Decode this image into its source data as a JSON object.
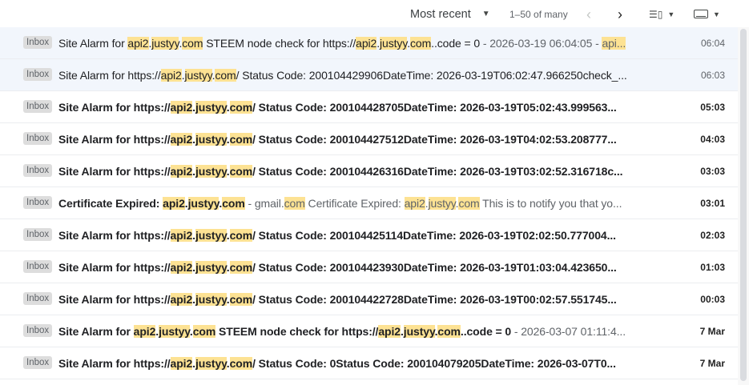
{
  "toolbar": {
    "sort_label": "Most recent",
    "range": "1–50 of many"
  },
  "emails": [
    {
      "label": "Inbox",
      "unread": false,
      "segments": [
        {
          "t": "Site Alarm for ",
          "s": "subject"
        },
        {
          "t": "api2",
          "s": "subject",
          "hl": true
        },
        {
          "t": ".",
          "s": "subject"
        },
        {
          "t": "justyy",
          "s": "subject",
          "hl": true
        },
        {
          "t": ".",
          "s": "subject"
        },
        {
          "t": "com",
          "s": "subject",
          "hl": true
        },
        {
          "t": " STEEM node check for https://",
          "s": "subject"
        },
        {
          "t": "api2",
          "s": "subject",
          "hl": true
        },
        {
          "t": ".",
          "s": "subject"
        },
        {
          "t": "justyy",
          "s": "subject",
          "hl": true
        },
        {
          "t": ".",
          "s": "subject"
        },
        {
          "t": "com",
          "s": "subject",
          "hl": true
        },
        {
          "t": "..code = 0",
          "s": "subject"
        },
        {
          "t": " - 2026-03-19 06:04:05 - ",
          "s": "snippet"
        },
        {
          "t": "api...",
          "s": "snippet",
          "hl": true
        }
      ],
      "date": "06:04"
    },
    {
      "label": "Inbox",
      "unread": false,
      "segments": [
        {
          "t": "Site Alarm for https://",
          "s": "subject"
        },
        {
          "t": "api2",
          "s": "subject",
          "hl": true
        },
        {
          "t": ".",
          "s": "subject"
        },
        {
          "t": "justyy",
          "s": "subject",
          "hl": true
        },
        {
          "t": ".",
          "s": "subject"
        },
        {
          "t": "com",
          "s": "subject",
          "hl": true
        },
        {
          "t": "/ Status Code: 200104429906DateTime: 2026-03-19T06:02:47.966250check_...",
          "s": "subject"
        }
      ],
      "date": "06:03"
    },
    {
      "label": "Inbox",
      "unread": true,
      "segments": [
        {
          "t": "Site Alarm for https://",
          "s": "subject"
        },
        {
          "t": "api2",
          "s": "subject",
          "hl": true
        },
        {
          "t": ".",
          "s": "subject"
        },
        {
          "t": "justyy",
          "s": "subject",
          "hl": true
        },
        {
          "t": ".",
          "s": "subject"
        },
        {
          "t": "com",
          "s": "subject",
          "hl": true
        },
        {
          "t": "/ Status Code: 200104428705DateTime: 2026-03-19T05:02:43.999563...",
          "s": "subject"
        }
      ],
      "date": "05:03"
    },
    {
      "label": "Inbox",
      "unread": true,
      "segments": [
        {
          "t": "Site Alarm for https://",
          "s": "subject"
        },
        {
          "t": "api2",
          "s": "subject",
          "hl": true
        },
        {
          "t": ".",
          "s": "subject"
        },
        {
          "t": "justyy",
          "s": "subject",
          "hl": true
        },
        {
          "t": ".",
          "s": "subject"
        },
        {
          "t": "com",
          "s": "subject",
          "hl": true
        },
        {
          "t": "/ Status Code: 200104427512DateTime: 2026-03-19T04:02:53.208777...",
          "s": "subject"
        }
      ],
      "date": "04:03"
    },
    {
      "label": "Inbox",
      "unread": true,
      "segments": [
        {
          "t": "Site Alarm for https://",
          "s": "subject"
        },
        {
          "t": "api2",
          "s": "subject",
          "hl": true
        },
        {
          "t": ".",
          "s": "subject"
        },
        {
          "t": "justyy",
          "s": "subject",
          "hl": true
        },
        {
          "t": ".",
          "s": "subject"
        },
        {
          "t": "com",
          "s": "subject",
          "hl": true
        },
        {
          "t": "/ Status Code: 200104426316DateTime: 2026-03-19T03:02:52.316718c...",
          "s": "subject"
        }
      ],
      "date": "03:03"
    },
    {
      "label": "Inbox",
      "unread": true,
      "segments": [
        {
          "t": "Certificate Expired: ",
          "s": "subject"
        },
        {
          "t": "api2",
          "s": "subject",
          "hl": true
        },
        {
          "t": ".",
          "s": "subject"
        },
        {
          "t": "justyy",
          "s": "subject",
          "hl": true
        },
        {
          "t": ".",
          "s": "subject"
        },
        {
          "t": "com",
          "s": "subject",
          "hl": true
        },
        {
          "t": " - gmail.",
          "s": "snippet"
        },
        {
          "t": "com",
          "s": "snippet",
          "hl": true
        },
        {
          "t": " Certificate Expired: ",
          "s": "snippet"
        },
        {
          "t": "api2",
          "s": "snippet",
          "hl": true
        },
        {
          "t": ".",
          "s": "snippet"
        },
        {
          "t": "justyy",
          "s": "snippet",
          "hl": true
        },
        {
          "t": ".",
          "s": "snippet"
        },
        {
          "t": "com",
          "s": "snippet",
          "hl": true
        },
        {
          "t": " This is to notify you that yo...",
          "s": "snippet"
        }
      ],
      "date": "03:01"
    },
    {
      "label": "Inbox",
      "unread": true,
      "segments": [
        {
          "t": "Site Alarm for https://",
          "s": "subject"
        },
        {
          "t": "api2",
          "s": "subject",
          "hl": true
        },
        {
          "t": ".",
          "s": "subject"
        },
        {
          "t": "justyy",
          "s": "subject",
          "hl": true
        },
        {
          "t": ".",
          "s": "subject"
        },
        {
          "t": "com",
          "s": "subject",
          "hl": true
        },
        {
          "t": "/ Status Code: 200104425114DateTime: 2026-03-19T02:02:50.777004...",
          "s": "subject"
        }
      ],
      "date": "02:03"
    },
    {
      "label": "Inbox",
      "unread": true,
      "segments": [
        {
          "t": "Site Alarm for https://",
          "s": "subject"
        },
        {
          "t": "api2",
          "s": "subject",
          "hl": true
        },
        {
          "t": ".",
          "s": "subject"
        },
        {
          "t": "justyy",
          "s": "subject",
          "hl": true
        },
        {
          "t": ".",
          "s": "subject"
        },
        {
          "t": "com",
          "s": "subject",
          "hl": true
        },
        {
          "t": "/ Status Code: 200104423930DateTime: 2026-03-19T01:03:04.423650...",
          "s": "subject"
        }
      ],
      "date": "01:03"
    },
    {
      "label": "Inbox",
      "unread": true,
      "segments": [
        {
          "t": "Site Alarm for https://",
          "s": "subject"
        },
        {
          "t": "api2",
          "s": "subject",
          "hl": true
        },
        {
          "t": ".",
          "s": "subject"
        },
        {
          "t": "justyy",
          "s": "subject",
          "hl": true
        },
        {
          "t": ".",
          "s": "subject"
        },
        {
          "t": "com",
          "s": "subject",
          "hl": true
        },
        {
          "t": "/ Status Code: 200104422728DateTime: 2026-03-19T00:02:57.551745...",
          "s": "subject"
        }
      ],
      "date": "00:03"
    },
    {
      "label": "Inbox",
      "unread": true,
      "segments": [
        {
          "t": "Site Alarm for ",
          "s": "subject"
        },
        {
          "t": "api2",
          "s": "subject",
          "hl": true
        },
        {
          "t": ".",
          "s": "subject"
        },
        {
          "t": "justyy",
          "s": "subject",
          "hl": true
        },
        {
          "t": ".",
          "s": "subject"
        },
        {
          "t": "com",
          "s": "subject",
          "hl": true
        },
        {
          "t": " STEEM node check for https://",
          "s": "subject"
        },
        {
          "t": "api2",
          "s": "subject",
          "hl": true
        },
        {
          "t": ".",
          "s": "subject"
        },
        {
          "t": "justyy",
          "s": "subject",
          "hl": true
        },
        {
          "t": ".",
          "s": "subject"
        },
        {
          "t": "com",
          "s": "subject",
          "hl": true
        },
        {
          "t": "..code = 0",
          "s": "subject"
        },
        {
          "t": " - 2026-03-07 01:11:4...",
          "s": "snippet"
        }
      ],
      "date": "7 Mar"
    },
    {
      "label": "Inbox",
      "unread": true,
      "segments": [
        {
          "t": "Site Alarm for https://",
          "s": "subject"
        },
        {
          "t": "api2",
          "s": "subject",
          "hl": true
        },
        {
          "t": ".",
          "s": "subject"
        },
        {
          "t": "justyy",
          "s": "subject",
          "hl": true
        },
        {
          "t": ".",
          "s": "subject"
        },
        {
          "t": "com",
          "s": "subject",
          "hl": true
        },
        {
          "t": "/ Status Code: 0Status Code: 200104079205DateTime: 2026-03-07T0...",
          "s": "subject"
        }
      ],
      "date": "7 Mar"
    }
  ]
}
